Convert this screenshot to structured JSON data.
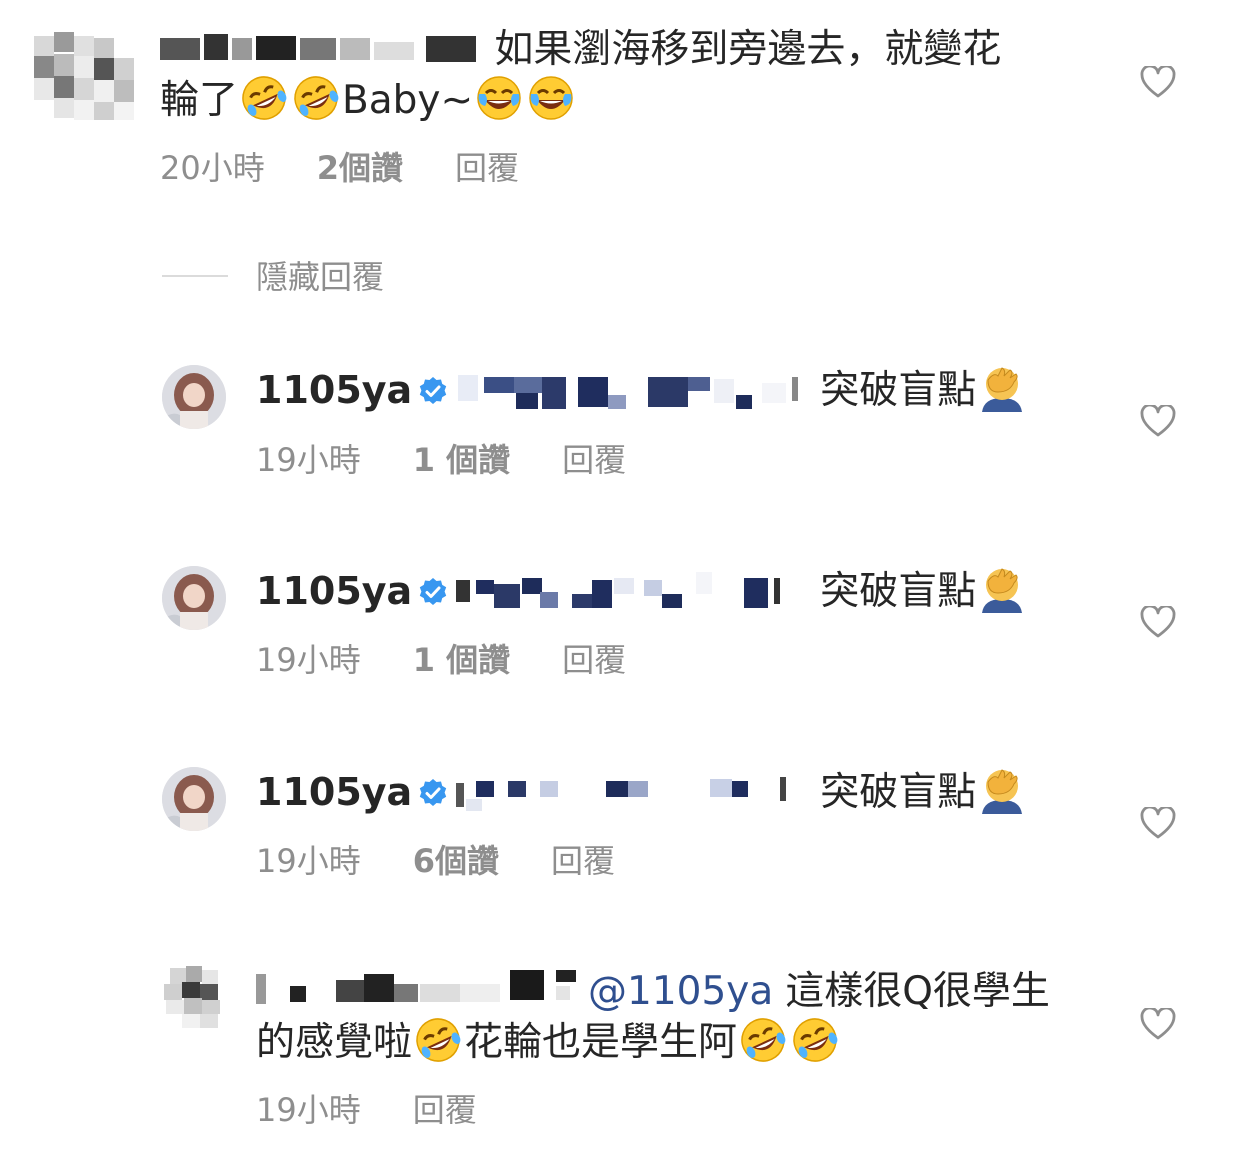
{
  "comments": [
    {
      "username": "",
      "text_line1": "如果瀏海移到旁邊去，就變花",
      "text_line2_prefix": "輪了",
      "text_line2_mid": "Baby~",
      "time": "20小時",
      "likes": "2個讚",
      "reply": "回覆"
    },
    {
      "hide_replies": "隱藏回覆"
    },
    {
      "username": "1105ya",
      "text": "突破盲點",
      "time": "19小時",
      "likes": "1 個讚",
      "reply": "回覆"
    },
    {
      "username": "1105ya",
      "text": "突破盲點",
      "time": "19小時",
      "likes": "1 個讚",
      "reply": "回覆"
    },
    {
      "username": "1105ya",
      "text": "突破盲點",
      "time": "19小時",
      "likes": "6個讚",
      "reply": "回覆"
    },
    {
      "mention": "@1105ya",
      "text_line1": "這樣很Q很學生",
      "text_line2_a": "的感覺啦",
      "text_line2_b": "花輪也是學生阿",
      "time": "19小時",
      "reply": "回覆"
    }
  ],
  "colors": {
    "text": "#262626",
    "meta": "#8e8e8e",
    "mention": "#2f4f8f",
    "verified": "#3897f0"
  },
  "icons": [
    "heart-outline-icon",
    "verified-badge-icon",
    "rolling-laughing-emoji",
    "tears-of-joy-emoji",
    "facepalm-emoji"
  ]
}
